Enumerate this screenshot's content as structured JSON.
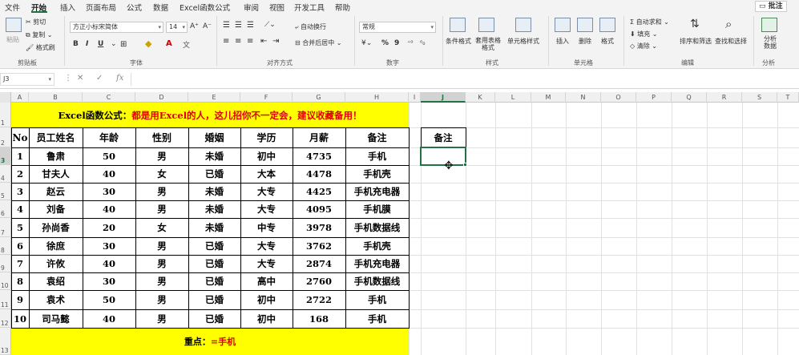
{
  "menu": {
    "tabs": [
      "文件",
      "开始",
      "插入",
      "页面布局",
      "公式",
      "数据",
      "Excel函数公式",
      "审阅",
      "视图",
      "开发工具",
      "帮助"
    ],
    "active": "开始",
    "comment_label": "批注"
  },
  "ribbon": {
    "clipboard": {
      "paste": "粘贴",
      "cut": "剪切",
      "copy": "复制",
      "format_painter": "格式刷",
      "label": "剪贴板"
    },
    "font": {
      "name": "方正小标宋简体",
      "size": "14",
      "label": "字体",
      "bold": "B",
      "italic": "I",
      "underline": "U"
    },
    "alignment": {
      "wrap": "自动换行",
      "merge": "合并后居中",
      "label": "对齐方式"
    },
    "number": {
      "format": "常规",
      "label": "数字",
      "percent": "%",
      "comma": "9"
    },
    "styles": {
      "cond": "条件格式",
      "table": "套用表格格式",
      "cell": "单元格样式",
      "label": "样式"
    },
    "cells": {
      "insert": "插入",
      "delete": "删除",
      "format": "格式",
      "label": "单元格"
    },
    "editing": {
      "autosum": "自动求和",
      "fill": "填充",
      "clear": "清除",
      "sort": "排序和筛选",
      "find": "查找和选择",
      "label": "编辑"
    },
    "analysis": {
      "analyze": "分析数据",
      "label": "分析"
    }
  },
  "formula_bar": {
    "name_box": "J3",
    "cancel": "✕",
    "enter": "✓",
    "fx": "fx",
    "value": ""
  },
  "columns": [
    "A",
    "B",
    "C",
    "D",
    "E",
    "F",
    "G",
    "H",
    "I",
    "J",
    "K",
    "L",
    "M",
    "N",
    "O",
    "P",
    "Q",
    "R",
    "S",
    "T"
  ],
  "rows": [
    "1",
    "2",
    "3",
    "4",
    "5",
    "6",
    "7",
    "8",
    "9",
    "10",
    "11",
    "12",
    "13"
  ],
  "selected_cell": {
    "col": "J",
    "row": "3"
  },
  "sheet": {
    "banner_prefix": "Excel函数公式：",
    "banner_text": "都是用Excel的人，这儿招你不一定会，建议收藏备用！",
    "headers": [
      "No",
      "员工姓名",
      "年龄",
      "性别",
      "婚姻",
      "学历",
      "月薪",
      "备注"
    ],
    "rows": [
      [
        "1",
        "鲁肃",
        "50",
        "男",
        "未婚",
        "初中",
        "4735",
        "手机"
      ],
      [
        "2",
        "甘夫人",
        "40",
        "女",
        "已婚",
        "大本",
        "4478",
        "手机壳"
      ],
      [
        "3",
        "赵云",
        "30",
        "男",
        "未婚",
        "大专",
        "4425",
        "手机充电器"
      ],
      [
        "4",
        "刘备",
        "40",
        "男",
        "未婚",
        "大专",
        "4095",
        "手机膜"
      ],
      [
        "5",
        "孙尚香",
        "20",
        "女",
        "未婚",
        "中专",
        "3978",
        "手机数据线"
      ],
      [
        "6",
        "徐庶",
        "30",
        "男",
        "已婚",
        "大专",
        "3762",
        "手机壳"
      ],
      [
        "7",
        "许攸",
        "40",
        "男",
        "已婚",
        "大专",
        "2874",
        "手机充电器"
      ],
      [
        "8",
        "袁绍",
        "30",
        "男",
        "已婚",
        "高中",
        "2760",
        "手机数据线"
      ],
      [
        "9",
        "袁术",
        "50",
        "男",
        "已婚",
        "初中",
        "2722",
        "手机"
      ],
      [
        "10",
        "司马懿",
        "40",
        "男",
        "已婚",
        "初中",
        "168",
        "手机"
      ]
    ],
    "j_header": "备注",
    "footer_prefix": "重点：",
    "footer_value": "=手机"
  },
  "colors": {
    "accent": "#217346",
    "highlight": "#ffff00",
    "red": "#e00000"
  }
}
